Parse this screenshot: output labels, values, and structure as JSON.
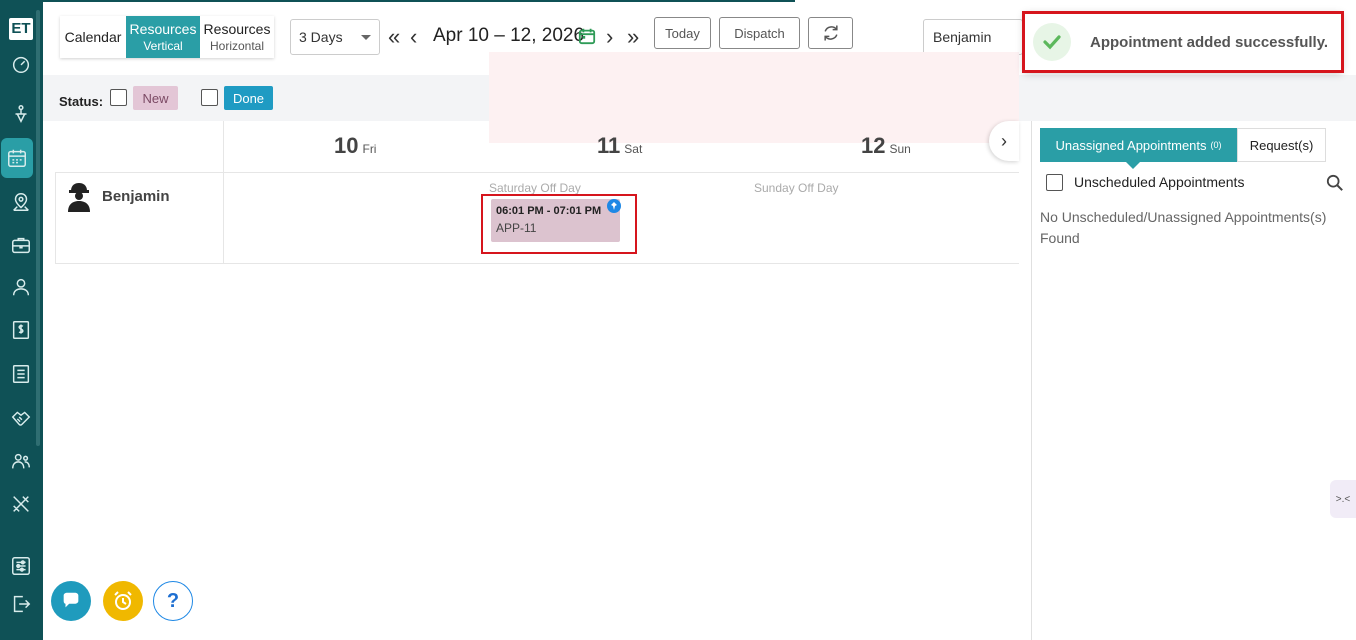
{
  "sidebar": {
    "logo": "ET",
    "items": [
      {
        "name": "dashboard-icon"
      },
      {
        "name": "dispatch-icon"
      },
      {
        "name": "calendar-icon",
        "active": true
      },
      {
        "name": "map-icon"
      },
      {
        "name": "briefcase-icon"
      },
      {
        "name": "user-icon"
      },
      {
        "name": "dollar-icon"
      },
      {
        "name": "list-icon"
      },
      {
        "name": "handshake-icon"
      },
      {
        "name": "team-icon"
      },
      {
        "name": "tools-icon"
      },
      {
        "name": "settings-icon"
      },
      {
        "name": "logout-icon"
      }
    ]
  },
  "toolbar": {
    "view_calendar": "Calendar",
    "view_resources_vertical_top": "Resources",
    "view_resources_vertical_sub": "Vertical",
    "view_resources_horizontal_top": "Resources",
    "view_resources_horizontal_sub": "Horizontal",
    "days_select": "3 Days",
    "date_range": "Apr 10 – 12, 2026",
    "today_label": "Today",
    "dispatch_label": "Dispatch",
    "user_select": "Benjamin"
  },
  "status": {
    "label": "Status:",
    "new_label": "New",
    "done_label": "Done"
  },
  "schedule": {
    "days": [
      {
        "num": "10",
        "name": "Fri"
      },
      {
        "num": "11",
        "name": "Sat"
      },
      {
        "num": "12",
        "name": "Sun"
      }
    ],
    "saturday_off": "Saturday Off Day",
    "sunday_off": "Sunday Off Day",
    "resource": "Benjamin",
    "appointment": {
      "time": "06:01 PM - 07:01 PM",
      "code": "APP-11"
    }
  },
  "right_panel": {
    "tab_unassigned": "Unassigned Appointments",
    "tab_unassigned_count": "(0)",
    "tab_requests": "Request(s)",
    "unscheduled_label": "Unscheduled Appointments",
    "empty_message": "No Unscheduled/Unassigned Appointments(s) Found",
    "side_handle": ">.<"
  },
  "toast": {
    "message": "Appointment added successfully."
  },
  "fab": {
    "help": "?"
  },
  "colors": {
    "sidebar": "#0f5156",
    "accent": "#2a9ea6",
    "highlight": "#d6151d"
  }
}
